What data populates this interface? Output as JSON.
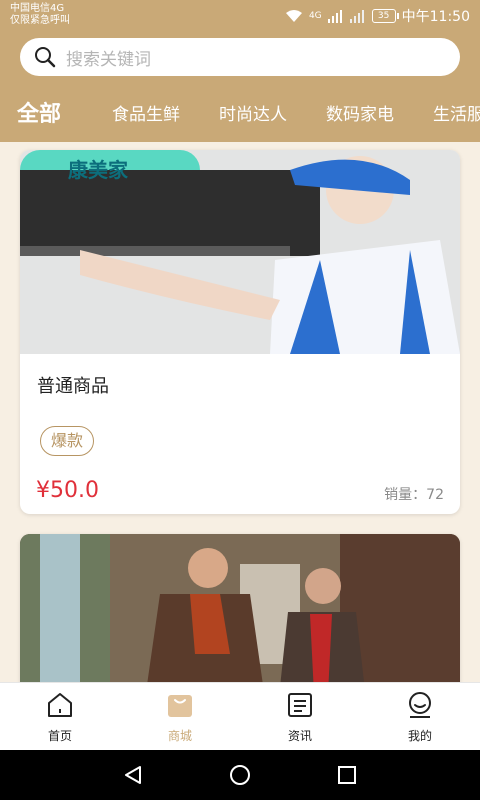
{
  "status_bar": {
    "carrier_line1": "中国电信4G",
    "carrier_line2": "仅限紧急呼叫",
    "network": "4G",
    "battery": "35",
    "time": "中午11:50"
  },
  "search": {
    "placeholder": "搜索关键词"
  },
  "categories": [
    {
      "label": "全部",
      "active": true
    },
    {
      "label": "食品生鲜"
    },
    {
      "label": "时尚达人"
    },
    {
      "label": "数码家电"
    },
    {
      "label": "生活服"
    }
  ],
  "products": [
    {
      "image_brand": "康美家",
      "title": "普通商品",
      "badge": "爆款",
      "price": "¥50.0",
      "sales": "销量：72"
    }
  ],
  "bottom_nav": [
    {
      "label": "首页",
      "icon": "home-icon"
    },
    {
      "label": "商城",
      "icon": "shop-bag-icon",
      "active": true
    },
    {
      "label": "资讯",
      "icon": "news-icon"
    },
    {
      "label": "我的",
      "icon": "profile-icon"
    }
  ],
  "colors": {
    "theme": "#c9a977",
    "price": "#e0303a",
    "badge": "#b79563"
  }
}
